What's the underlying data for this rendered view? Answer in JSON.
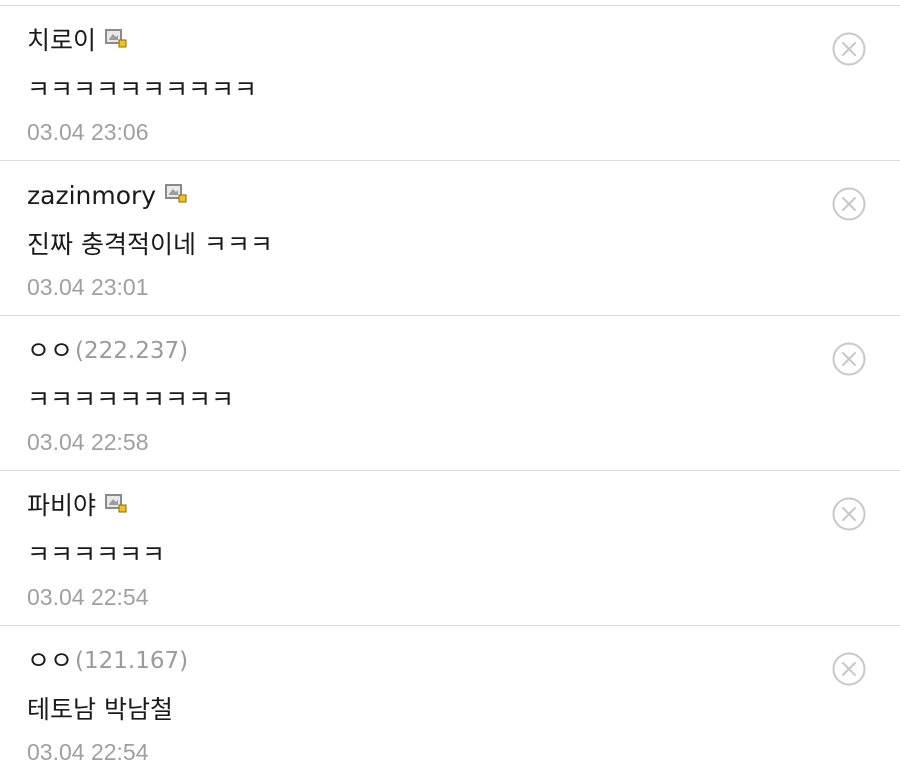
{
  "comments": [
    {
      "author": "치로이",
      "ip": "",
      "member_icon": "member-badge-icon",
      "text": "ㅋㅋㅋㅋㅋㅋㅋㅋㅋㅋ",
      "time": "03.04 23:06",
      "delete_icon": "circle-x-icon"
    },
    {
      "author": "zazinmory",
      "ip": "",
      "member_icon": "member-badge-icon",
      "text": "진짜 충격적이네 ㅋㅋㅋ",
      "time": "03.04 23:01",
      "delete_icon": "circle-x-icon"
    },
    {
      "author": "ㅇㅇ",
      "ip": "(222.237)",
      "member_icon": "",
      "text": "ㅋㅋㅋㅋㅋㅋㅋㅋㅋ",
      "time": "03.04 22:58",
      "delete_icon": "circle-x-icon"
    },
    {
      "author": "파비야",
      "ip": "",
      "member_icon": "member-badge-icon",
      "text": "ㅋㅋㅋㅋㅋㅋ",
      "time": "03.04 22:54",
      "delete_icon": "circle-x-icon"
    },
    {
      "author": "ㅇㅇ",
      "ip": "(121.167)",
      "member_icon": "",
      "text": "테토남 박남철",
      "time": "03.04 22:54",
      "delete_icon": "circle-x-icon"
    }
  ],
  "colors": {
    "text": "#1a1a1a",
    "muted": "#a0a0a0",
    "divider": "#dcdcdc",
    "delete_icon": "#c8c8c8"
  }
}
